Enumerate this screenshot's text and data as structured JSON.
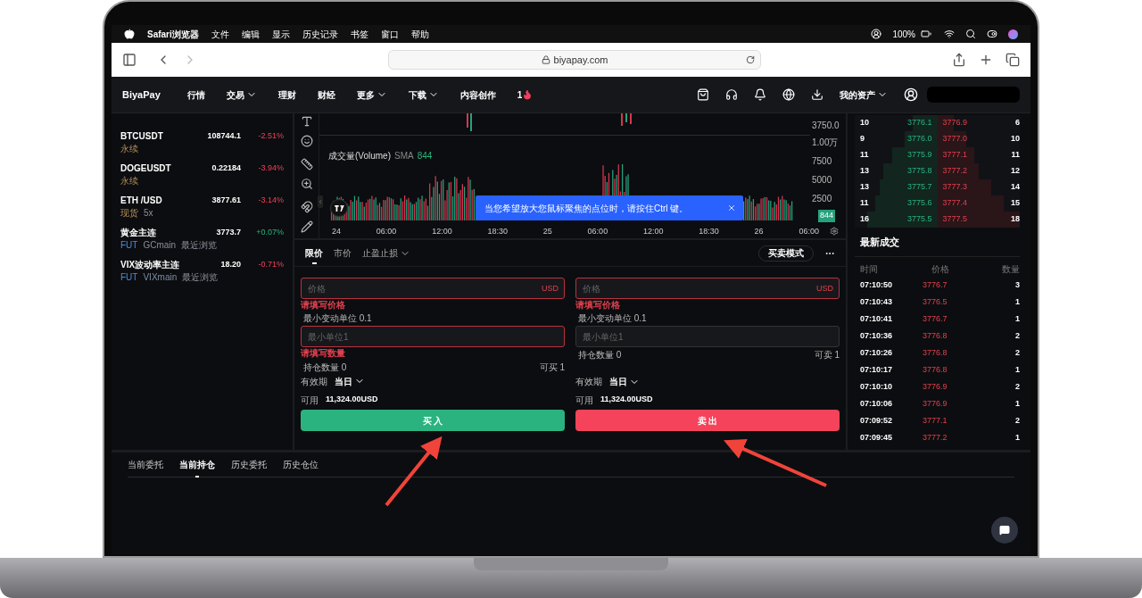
{
  "menubar": {
    "app": "Safari浏览器",
    "items": [
      "文件",
      "编辑",
      "显示",
      "历史记录",
      "书签",
      "窗口",
      "帮助"
    ],
    "battery": "100%"
  },
  "browser": {
    "url": "biyapay.com"
  },
  "site_nav": {
    "logo": "BiyaPay",
    "items": [
      {
        "label": "行情",
        "dropdown": false
      },
      {
        "label": "交易",
        "dropdown": true
      },
      {
        "label": "理财",
        "dropdown": false
      },
      {
        "label": "财经",
        "dropdown": false
      },
      {
        "label": "更多",
        "dropdown": true
      },
      {
        "label": "下载",
        "dropdown": true
      },
      {
        "label": "内容创作",
        "dropdown": false
      }
    ],
    "hot_count": "1",
    "account": {
      "label": "我的资产",
      "dropdown": true
    }
  },
  "watchlist": [
    {
      "symbol": "BTCUSDT",
      "tags": [
        {
          "text": "永续",
          "kind": "type"
        }
      ],
      "price": "108744.1",
      "change": "-2.51%",
      "rising": false
    },
    {
      "symbol": "DOGEUSDT",
      "tags": [
        {
          "text": "永续",
          "kind": "type"
        }
      ],
      "price": "0.22184",
      "change": "-3.94%",
      "rising": false
    },
    {
      "symbol": "ETH /USD",
      "tags": [
        {
          "text": "现货",
          "kind": "type"
        },
        {
          "text": "5x",
          "kind": "note"
        }
      ],
      "price": "3877.61",
      "change": "-3.14%",
      "rising": false
    },
    {
      "symbol": "黄金主连",
      "tags": [
        {
          "text": "FUT",
          "kind": "market"
        },
        {
          "text": "GCmain",
          "kind": "note"
        },
        {
          "text": "最近浏览",
          "kind": "note"
        }
      ],
      "price": "3773.7",
      "change": "+0.07%",
      "rising": true
    },
    {
      "symbol": "VIX波动率主连",
      "tags": [
        {
          "text": "FUT",
          "kind": "market"
        },
        {
          "text": "VIXmain",
          "kind": "code"
        },
        {
          "text": "最近浏览",
          "kind": "note"
        }
      ],
      "price": "18.20",
      "change": "-0.71%",
      "rising": false
    }
  ],
  "chart": {
    "price_label": "3750.0",
    "volume_label": "成交量(Volume)",
    "sma": "SMA",
    "sma_value": "844",
    "y_labels": [
      "1.00万",
      "7500",
      "5000",
      "2500"
    ],
    "last_badge": "844",
    "x_labels": [
      "24",
      "06:00",
      "12:00",
      "18:30",
      "25",
      "06:00",
      "12:00",
      "18:30",
      "26",
      "06:00"
    ],
    "toast": "当您希望放大您鼠标聚焦的点位时，请按住Ctrl 键。"
  },
  "order": {
    "tabs": [
      {
        "label": "限价",
        "selected": true,
        "dropdown": false
      },
      {
        "label": "市价",
        "selected": false,
        "dropdown": false
      },
      {
        "label": "止盈止损",
        "selected": false,
        "dropdown": true
      }
    ],
    "mode_button": "买卖模式",
    "sides": [
      {
        "kind": "buy",
        "price_placeholder": "价格",
        "currency": "USD",
        "price_error": "请填写价格",
        "tick": "最小变动单位 0.1",
        "qty_placeholder": "最小单位1",
        "qty_error": "请填写数量",
        "position": "持仓数量 0",
        "max_qty": "可买 1",
        "validity_label": "有效期",
        "validity": "当日",
        "available_label": "可用",
        "available": "11,324.00USD",
        "button": "买 入"
      },
      {
        "kind": "sell",
        "price_placeholder": "价格",
        "currency": "USD",
        "price_error": "请填写价格",
        "tick": "最小变动单位 0.1",
        "qty_placeholder": "最小单位1",
        "position": "持仓数量 0",
        "max_qty": "可卖 1",
        "validity_label": "有效期",
        "validity": "当日",
        "available_label": "可用",
        "available": "11,324.00USD",
        "button": "卖 出"
      }
    ]
  },
  "order_book": [
    {
      "bid": {
        "qty": "10",
        "price": "3776.1",
        "level": 0.3
      },
      "ask": {
        "price": "3776.9",
        "qty": "6",
        "level": 0.2
      }
    },
    {
      "bid": {
        "qty": "9",
        "price": "3776.0",
        "level": 0.4
      },
      "ask": {
        "price": "3777.0",
        "qty": "10",
        "level": 0.35
      }
    },
    {
      "bid": {
        "qty": "11",
        "price": "3775.9",
        "level": 0.55
      },
      "ask": {
        "price": "3777.1",
        "qty": "11",
        "level": 0.45
      }
    },
    {
      "bid": {
        "qty": "13",
        "price": "3775.8",
        "level": 0.65
      },
      "ask": {
        "price": "3777.2",
        "qty": "12",
        "level": 0.5
      }
    },
    {
      "bid": {
        "qty": "13",
        "price": "3775.7",
        "level": 0.7
      },
      "ask": {
        "price": "3777.3",
        "qty": "14",
        "level": 0.65
      }
    },
    {
      "bid": {
        "qty": "11",
        "price": "3775.6",
        "level": 0.75
      },
      "ask": {
        "price": "3777.4",
        "qty": "15",
        "level": 0.8
      }
    },
    {
      "bid": {
        "qty": "16",
        "price": "3775.5",
        "level": 0.85
      },
      "ask": {
        "price": "3777.5",
        "qty": "18",
        "level": 1.0
      }
    }
  ],
  "trades": {
    "title": "最新成交",
    "columns": [
      "时间",
      "价格",
      "数量"
    ],
    "rows": [
      {
        "time": "07:10:50",
        "price": "3776.7",
        "qty": "3",
        "rising": false
      },
      {
        "time": "07:10:43",
        "price": "3776.5",
        "qty": "1",
        "rising": false
      },
      {
        "time": "07:10:41",
        "price": "3776.7",
        "qty": "1",
        "rising": false
      },
      {
        "time": "07:10:36",
        "price": "3776.8",
        "qty": "2",
        "rising": false
      },
      {
        "time": "07:10:26",
        "price": "3776.8",
        "qty": "2",
        "rising": false
      },
      {
        "time": "07:10:17",
        "price": "3776.8",
        "qty": "1",
        "rising": false
      },
      {
        "time": "07:10:10",
        "price": "3776.9",
        "qty": "2",
        "rising": false
      },
      {
        "time": "07:10:06",
        "price": "3776.9",
        "qty": "1",
        "rising": false
      },
      {
        "time": "07:09:52",
        "price": "3777.1",
        "qty": "2",
        "rising": false
      },
      {
        "time": "07:09:45",
        "price": "3777.2",
        "qty": "1",
        "rising": false
      }
    ]
  },
  "bottom_tabs": [
    {
      "label": "当前委托",
      "selected": false
    },
    {
      "label": "当前持仓",
      "selected": true
    },
    {
      "label": "历史委托",
      "selected": false
    },
    {
      "label": "历史仓位",
      "selected": false
    }
  ]
}
